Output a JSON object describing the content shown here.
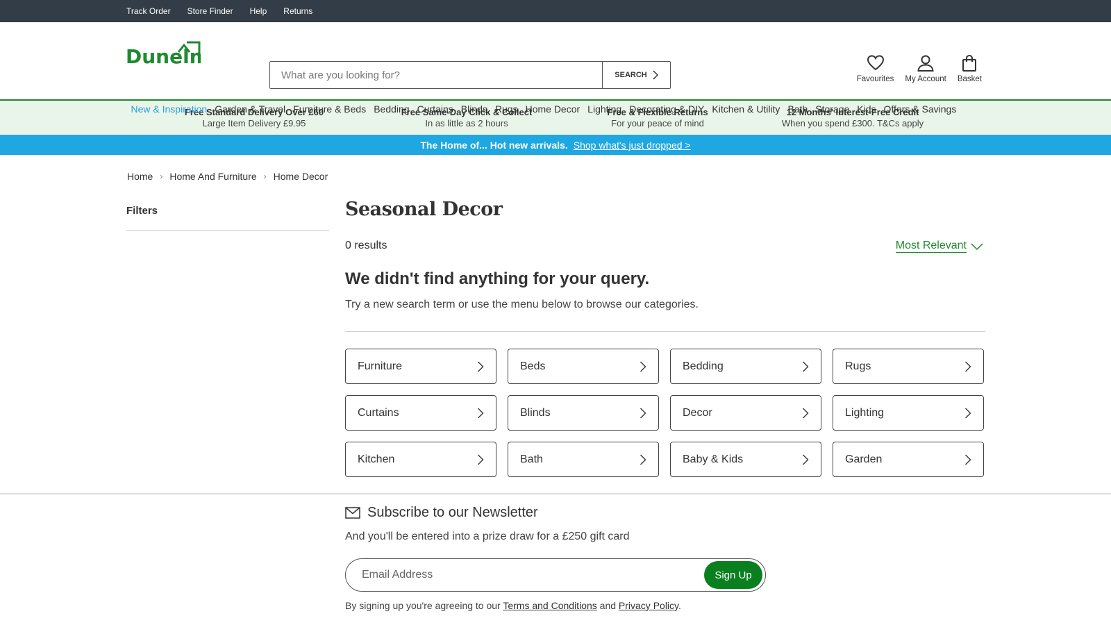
{
  "utility": {
    "links": [
      "Track Order",
      "Store Finder",
      "Help",
      "Returns"
    ]
  },
  "header": {
    "logo_text": "Dunelm",
    "search_placeholder": "What are you looking for?",
    "search_button": "SEARCH",
    "actions": {
      "favourites": "Favourites",
      "account": "My Account",
      "basket": "Basket"
    }
  },
  "nav": {
    "items": [
      "New & Inspiration",
      "Garden & Travel",
      "Furniture & Beds",
      "Bedding",
      "Curtains",
      "Blinds",
      "Rugs",
      "Home Decor",
      "Lighting",
      "Decorating & DIY",
      "Kitchen & Utility",
      "Bath",
      "Storage",
      "Kids",
      "Offers & Savings"
    ]
  },
  "usps": [
    {
      "title": "Free Standard Delivery Over £60",
      "sub": "Large Item Delivery £9.95"
    },
    {
      "title": "Free Same-Day Click & Collect",
      "sub": "In as little as 2 hours"
    },
    {
      "title": "Free & Flexible Returns",
      "sub": "For your peace of mind"
    },
    {
      "title": "12 Months' Interest-Free Credit",
      "sub": "When you spend £300. T&Cs apply"
    }
  ],
  "promo": {
    "text": "The Home of... Hot new arrivals.",
    "link": "Shop what's just dropped >"
  },
  "breadcrumb": [
    "Home",
    "Home And Furniture",
    "Home Decor"
  ],
  "filters": {
    "title": "Filters"
  },
  "page": {
    "title": "Seasonal Decor",
    "results": "0 results",
    "sort_label": "Most Relevant",
    "empty_title": "We didn't find anything for your query.",
    "empty_sub": "Try a new search term or use the menu below to browse our categories."
  },
  "categories": [
    "Furniture",
    "Beds",
    "Bedding",
    "Rugs",
    "Curtains",
    "Blinds",
    "Decor",
    "Lighting",
    "Kitchen",
    "Bath",
    "Baby & Kids",
    "Garden"
  ],
  "newsletter": {
    "title": "Subscribe to our Newsletter",
    "sub": "And you'll be entered into a prize draw for a £250 gift card",
    "email_placeholder": "Email Address",
    "button": "Sign Up",
    "terms_prefix": "By signing up you're agreeing to our",
    "terms_link": "Terms and Conditions",
    "and": "and",
    "privacy_link": "Privacy Policy",
    "terms_suffix": "."
  },
  "colors": {
    "brand_green": "#1e8a2f",
    "accent_blue": "#1ea7e0",
    "utility_bg": "#333d47",
    "usp_bg": "#eaf5ea"
  }
}
